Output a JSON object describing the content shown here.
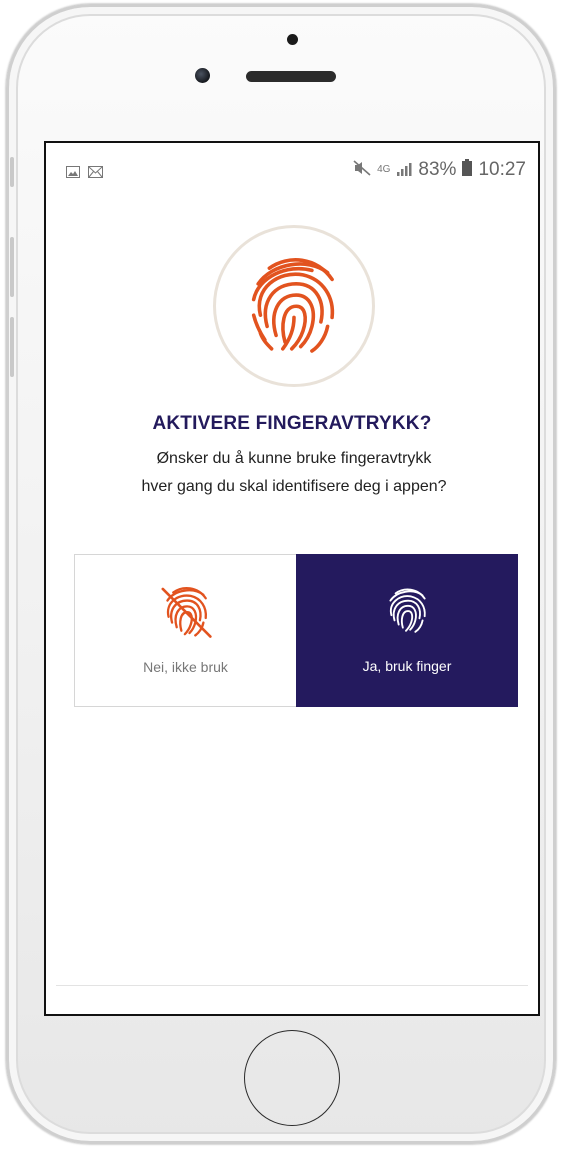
{
  "colors": {
    "accent_orange": "#e2531f",
    "brand_navy": "#241a5e",
    "circle_ring": "#e9e2d9"
  },
  "statusbar": {
    "left_icons": [
      "image-icon",
      "mail-icon"
    ],
    "right_icons": [
      "mute-icon",
      "4g-icon",
      "signal-icon",
      "battery-icon"
    ],
    "network": "4G",
    "battery": "83%",
    "time": "10:27"
  },
  "dialog": {
    "hero_icon": "fingerprint-icon",
    "title": "AKTIVERE FINGERAVTRYKK?",
    "subtitle_line1": "Ønsker du å kunne bruke fingeravtrykk",
    "subtitle_line2": "hver gang du skal identifisere deg i appen?",
    "options": [
      {
        "label": "Nei, ikke bruk",
        "icon": "fingerprint-disabled-icon"
      },
      {
        "label": "Ja, bruk finger",
        "icon": "fingerprint-icon"
      }
    ]
  }
}
